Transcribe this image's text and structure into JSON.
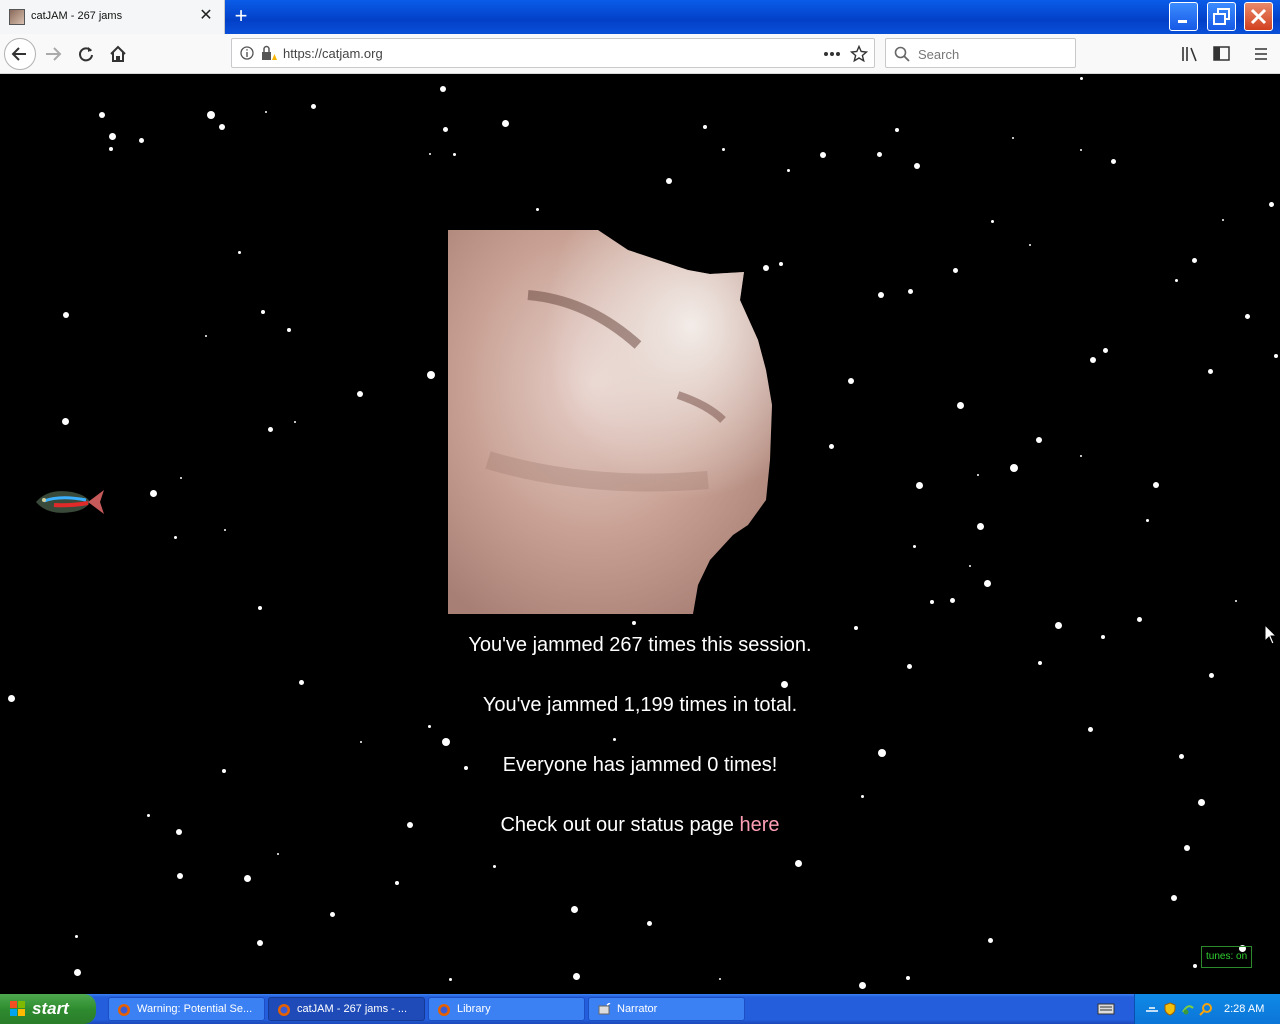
{
  "browser": {
    "tab_title": "catJAM - 267 jams",
    "url": "https://catjam.org",
    "search_placeholder": "Search"
  },
  "page": {
    "session_line": "You've jammed 267 times this session.",
    "total_line": "You've jammed 1,199 times in total.",
    "everyone_line": "Everyone has jammed 0 times!",
    "status_prefix": "Check out our status page ",
    "status_link": "here",
    "tunes_toggle": "tunes: on",
    "link_color": "#ff9fb5"
  },
  "taskbar": {
    "start_label": "start",
    "tasks": [
      {
        "label": "Warning: Potential Se...",
        "icon": "firefox-icon"
      },
      {
        "label": "catJAM - 267 jams - ...",
        "icon": "firefox-icon",
        "active": true
      },
      {
        "label": "Library",
        "icon": "firefox-icon"
      },
      {
        "label": "Narrator",
        "icon": "narrator-icon"
      }
    ],
    "clock": "2:28 AM"
  }
}
